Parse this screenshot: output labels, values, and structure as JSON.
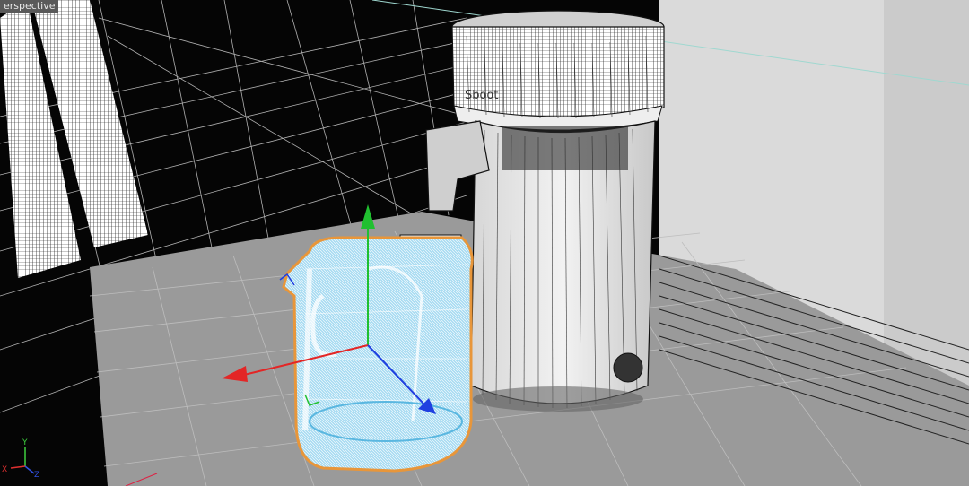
{
  "viewport": {
    "label": "Perspective",
    "label_visible": "erspective",
    "brand_text": "Sboot"
  },
  "axis_indicator": {
    "x_label": "X",
    "y_label": "Y",
    "z_label": "Z"
  },
  "gizmo": {
    "x_color": "#e32626",
    "y_color": "#20c030",
    "z_color": "#2040e0"
  },
  "colors": {
    "selection_outline": "#e8963a",
    "selected_wire": "#7fd2f2",
    "wireframe": "#1a1a1a",
    "floor": "#9a9a9a"
  }
}
